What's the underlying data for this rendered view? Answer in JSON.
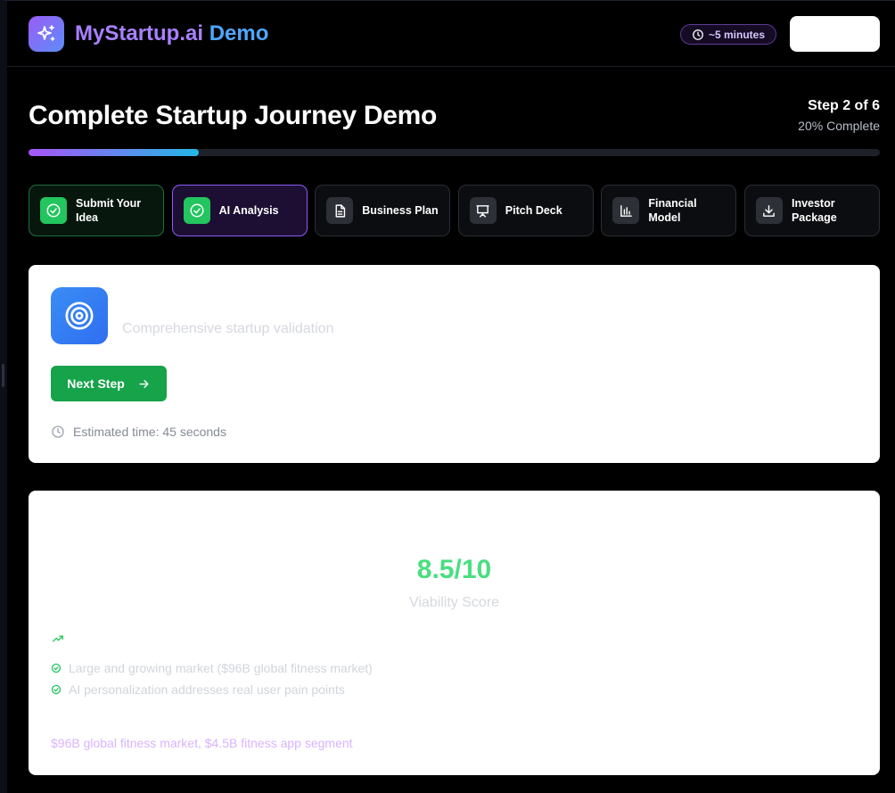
{
  "header": {
    "brand_part1": "MyStartup.ai",
    "brand_part2": "Demo",
    "duration": "~5 minutes",
    "logo_icon": "sparkles-icon"
  },
  "journey": {
    "title": "Complete Startup Journey Demo",
    "step_label": "Step 2 of 6",
    "percent_label": "20% Complete",
    "progress": 0.2
  },
  "steps": [
    {
      "label": "Submit Your Idea",
      "icon": "check-circle-icon",
      "state": "done"
    },
    {
      "label": "AI Analysis",
      "icon": "check-circle-icon",
      "state": "active"
    },
    {
      "label": "Business Plan",
      "icon": "document-icon",
      "state": "pending"
    },
    {
      "label": "Pitch Deck",
      "icon": "presentation-icon",
      "state": "pending"
    },
    {
      "label": "Financial Model",
      "icon": "bar-chart-icon",
      "state": "pending"
    },
    {
      "label": "Investor Package",
      "icon": "download-icon",
      "state": "pending"
    }
  ],
  "current_step": {
    "icon": "target-icon",
    "subtitle": "Comprehensive startup validation",
    "next_button": "Next Step",
    "estimated_time": "Estimated time: 45 seconds"
  },
  "analysis": {
    "score": "8.5/10",
    "score_label": "Viability Score",
    "strengths": [
      "Large and growing market ($96B global fitness market)",
      "AI personalization addresses real user pain points"
    ],
    "market_size": "$96B global fitness market, $4.5B fitness app segment"
  },
  "colors": {
    "accent_purple": "#a855f7",
    "accent_blue": "#4da7ff",
    "success_green": "#22c55e",
    "score_green": "#4ade80",
    "button_green": "#16a34a"
  }
}
